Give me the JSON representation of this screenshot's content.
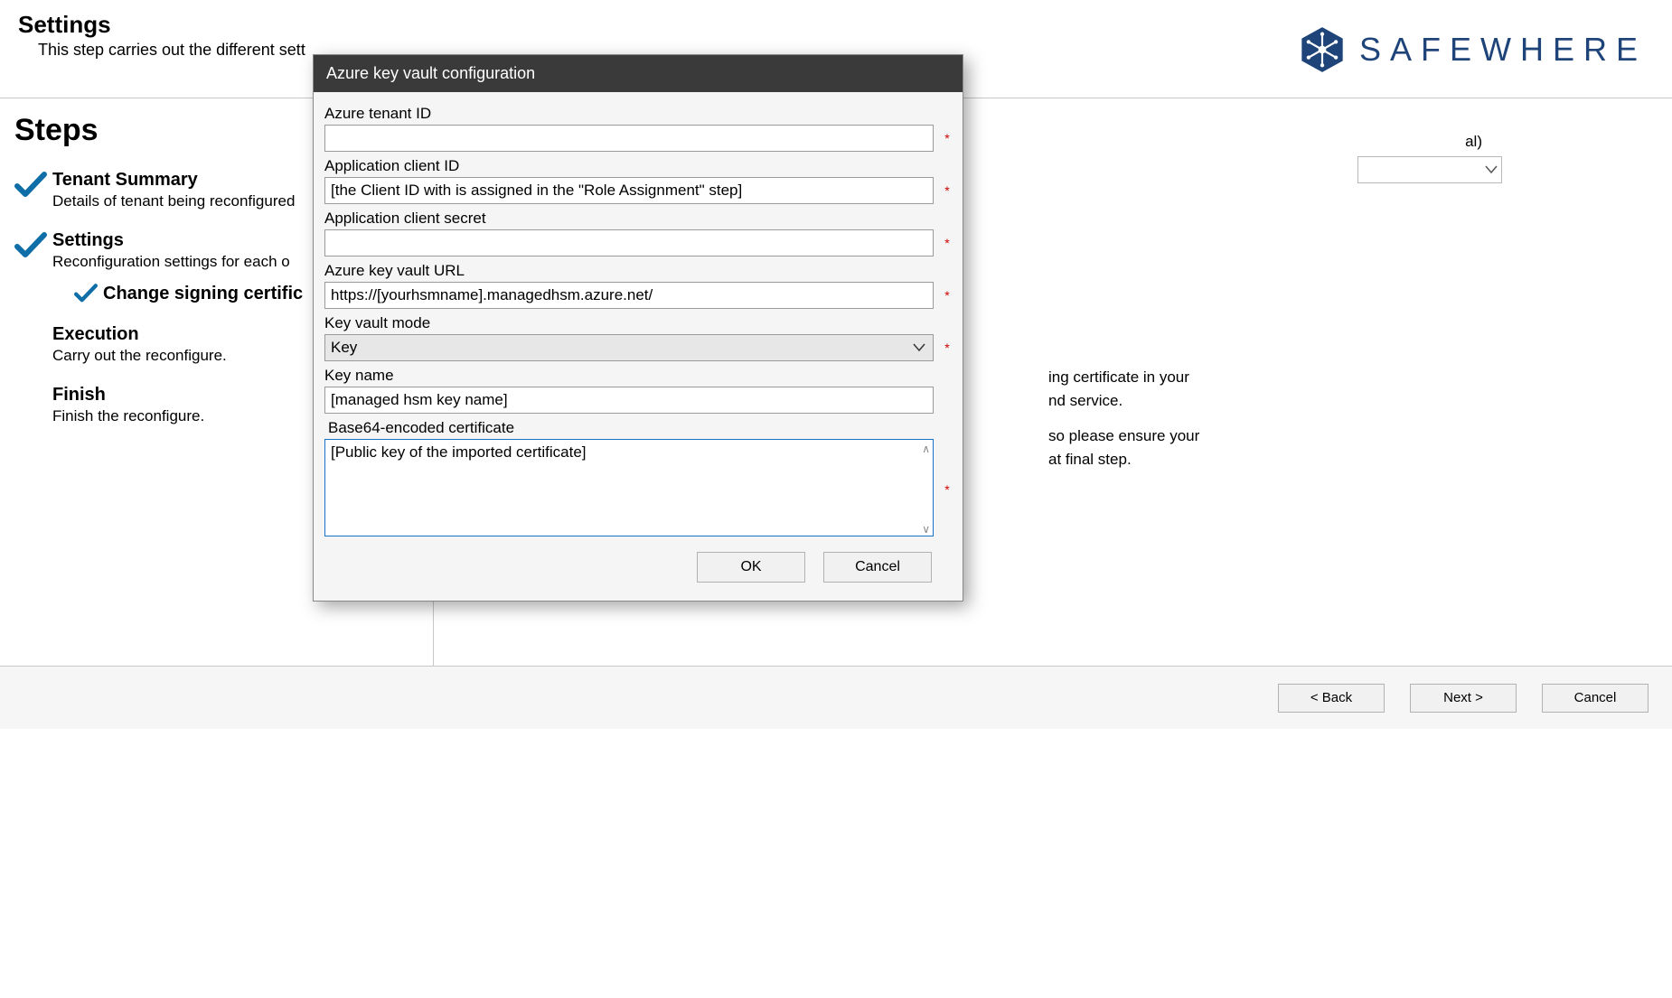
{
  "brand": {
    "name": "SAFEWHERE"
  },
  "header": {
    "title": "Settings",
    "subtitle": "This step carries out the different sett"
  },
  "sidebar": {
    "heading": "Steps",
    "items": [
      {
        "title": "Tenant Summary",
        "desc": "Details of tenant being reconfigured",
        "checked": true
      },
      {
        "title": "Settings",
        "desc": "Reconfiguration settings for each o",
        "checked": true,
        "sub": {
          "title": "Change signing certific",
          "checked": true
        }
      },
      {
        "title": "Execution",
        "desc": "Carry out the reconfigure.",
        "checked": false
      },
      {
        "title": "Finish",
        "desc": "Finish the reconfigure.",
        "checked": false
      }
    ]
  },
  "content": {
    "dropdown_hint": "al)",
    "info1_tail1": "ing certificate in your",
    "info1_tail2": "nd service.",
    "info2_tail1": "so please ensure your",
    "info2_tail2": "at final step."
  },
  "wizard_nav": {
    "back": "< Back",
    "next": "Next >",
    "cancel": "Cancel"
  },
  "dialog": {
    "title": "Azure key vault configuration",
    "fields": {
      "tenant_id": {
        "label": "Azure tenant ID",
        "value": "",
        "required": true
      },
      "client_id": {
        "label": "Application client ID",
        "value": "[the Client ID with is assigned in the \"Role Assignment\" step]",
        "required": true
      },
      "client_secret": {
        "label": "Application client secret",
        "value": "",
        "required": true
      },
      "vault_url": {
        "label": "Azure key vault URL",
        "value": "https://[yourhsmname].managedhsm.azure.net/",
        "required": true
      },
      "vault_mode": {
        "label": "Key vault mode",
        "value": "Key",
        "required": true
      },
      "key_name": {
        "label": "Key name",
        "value": "[managed hsm key name]",
        "required": false
      },
      "b64_cert": {
        "label": "Base64-encoded certificate",
        "value": "[Public key of the imported certificate]",
        "required": true
      }
    },
    "buttons": {
      "ok": "OK",
      "cancel": "Cancel"
    }
  }
}
